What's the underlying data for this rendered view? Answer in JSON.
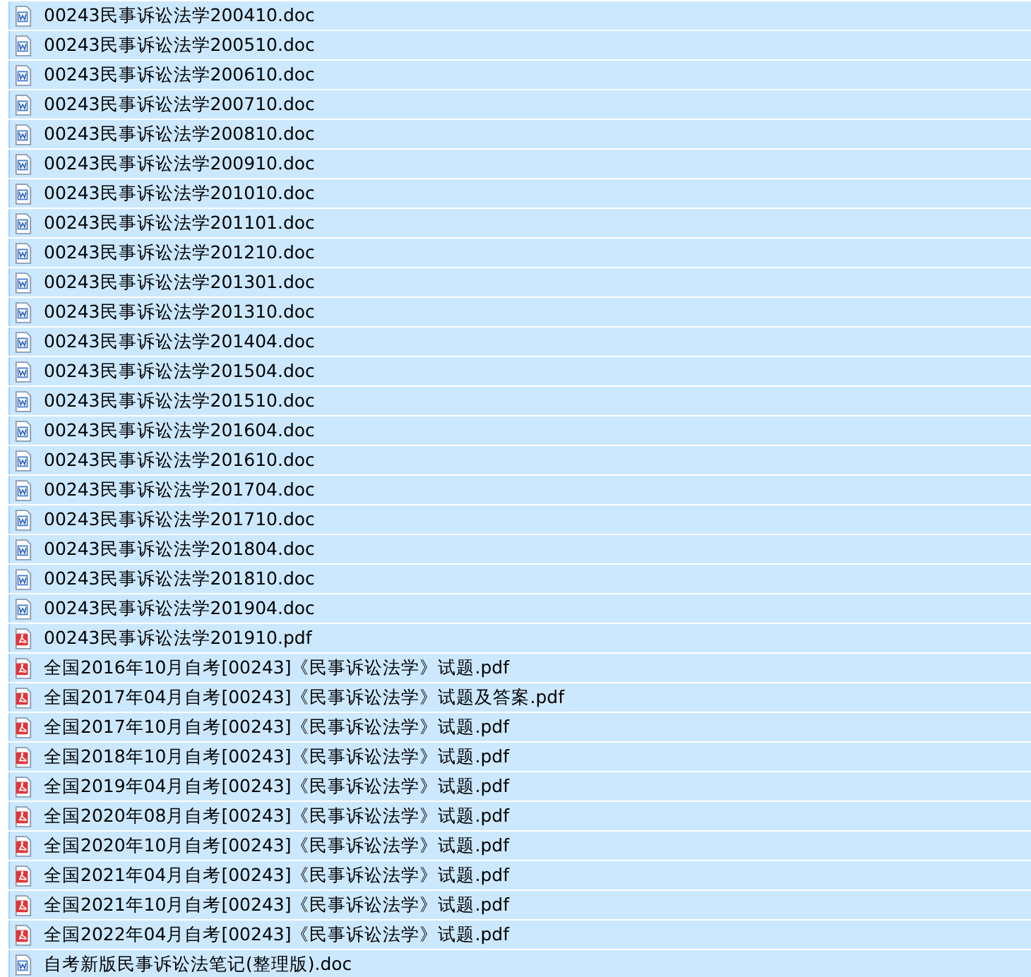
{
  "files": [
    {
      "name": "00243民事诉讼法学200410.doc",
      "kind": "doc",
      "selected": true
    },
    {
      "name": "00243民事诉讼法学200510.doc",
      "kind": "doc",
      "selected": true
    },
    {
      "name": "00243民事诉讼法学200610.doc",
      "kind": "doc",
      "selected": true
    },
    {
      "name": "00243民事诉讼法学200710.doc",
      "kind": "doc",
      "selected": true
    },
    {
      "name": "00243民事诉讼法学200810.doc",
      "kind": "doc",
      "selected": true
    },
    {
      "name": "00243民事诉讼法学200910.doc",
      "kind": "doc",
      "selected": true
    },
    {
      "name": "00243民事诉讼法学201010.doc",
      "kind": "doc",
      "selected": true
    },
    {
      "name": "00243民事诉讼法学201101.doc",
      "kind": "doc",
      "selected": true
    },
    {
      "name": "00243民事诉讼法学201210.doc",
      "kind": "doc",
      "selected": true
    },
    {
      "name": "00243民事诉讼法学201301.doc",
      "kind": "doc",
      "selected": true
    },
    {
      "name": "00243民事诉讼法学201310.doc",
      "kind": "doc",
      "selected": true
    },
    {
      "name": "00243民事诉讼法学201404.doc",
      "kind": "doc",
      "selected": true
    },
    {
      "name": "00243民事诉讼法学201504.doc",
      "kind": "doc",
      "selected": true
    },
    {
      "name": "00243民事诉讼法学201510.doc",
      "kind": "doc",
      "selected": true
    },
    {
      "name": "00243民事诉讼法学201604.doc",
      "kind": "doc",
      "selected": true
    },
    {
      "name": "00243民事诉讼法学201610.doc",
      "kind": "doc",
      "selected": true
    },
    {
      "name": "00243民事诉讼法学201704.doc",
      "kind": "doc",
      "selected": true
    },
    {
      "name": "00243民事诉讼法学201710.doc",
      "kind": "doc",
      "selected": true
    },
    {
      "name": "00243民事诉讼法学201804.doc",
      "kind": "doc",
      "selected": true
    },
    {
      "name": "00243民事诉讼法学201810.doc",
      "kind": "doc",
      "selected": true
    },
    {
      "name": "00243民事诉讼法学201904.doc",
      "kind": "doc",
      "selected": true
    },
    {
      "name": "00243民事诉讼法学201910.pdf",
      "kind": "pdf",
      "selected": true
    },
    {
      "name": "全国2016年10月自考[00243]《民事诉讼法学》试题.pdf",
      "kind": "pdf",
      "selected": true
    },
    {
      "name": "全国2017年04月自考[00243]《民事诉讼法学》试题及答案.pdf",
      "kind": "pdf",
      "selected": true
    },
    {
      "name": "全国2017年10月自考[00243]《民事诉讼法学》试题.pdf",
      "kind": "pdf",
      "selected": true
    },
    {
      "name": "全国2018年10月自考[00243]《民事诉讼法学》试题.pdf",
      "kind": "pdf",
      "selected": true
    },
    {
      "name": "全国2019年04月自考[00243]《民事诉讼法学》试题.pdf",
      "kind": "pdf",
      "selected": true
    },
    {
      "name": "全国2020年08月自考[00243]《民事诉讼法学》试题.pdf",
      "kind": "pdf",
      "selected": true
    },
    {
      "name": "全国2020年10月自考[00243]《民事诉讼法学》试题.pdf",
      "kind": "pdf",
      "selected": true
    },
    {
      "name": "全国2021年04月自考[00243]《民事诉讼法学》试题.pdf",
      "kind": "pdf",
      "selected": true
    },
    {
      "name": "全国2021年10月自考[00243]《民事诉讼法学》试题.pdf",
      "kind": "pdf",
      "selected": true
    },
    {
      "name": "全国2022年04月自考[00243]《民事诉讼法学》试题.pdf",
      "kind": "pdf",
      "selected": true
    },
    {
      "name": "自考新版民事诉讼法笔记(整理版).doc",
      "kind": "doc",
      "selected": true
    }
  ]
}
